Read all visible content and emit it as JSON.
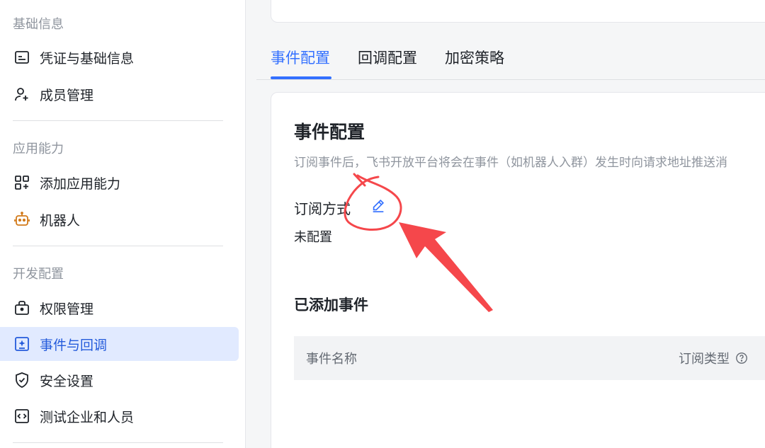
{
  "sidebar": {
    "sections": [
      {
        "title": "基础信息"
      },
      {
        "title": "应用能力"
      },
      {
        "title": "开发配置"
      }
    ],
    "items": [
      {
        "label": "凭证与基础信息",
        "icon": "credential-icon"
      },
      {
        "label": "成员管理",
        "icon": "member-add-icon"
      },
      {
        "label": "添加应用能力",
        "icon": "app-grid-add-icon"
      },
      {
        "label": "机器人",
        "icon": "robot-icon"
      },
      {
        "label": "权限管理",
        "icon": "permission-lock-icon"
      },
      {
        "label": "事件与回调",
        "icon": "event-callback-icon",
        "active": true
      },
      {
        "label": "安全设置",
        "icon": "shield-check-icon"
      },
      {
        "label": "测试企业和人员",
        "icon": "code-doc-icon"
      }
    ]
  },
  "tabs": [
    {
      "label": "事件配置",
      "active": true
    },
    {
      "label": "回调配置"
    },
    {
      "label": "加密策略"
    }
  ],
  "content": {
    "title": "事件配置",
    "description": "订阅事件后，飞书开放平台将会在事件（如机器人入群）发生时向请求地址推送消",
    "subscription_label": "订阅方式",
    "subscription_status": "未配置",
    "events_title": "已添加事件",
    "table_headers": {
      "name": "事件名称",
      "type": "订阅类型"
    }
  },
  "colors": {
    "accent": "#3370ff",
    "active_bg": "#e1eaff",
    "annotation_red": "#f5474b",
    "robot_orange": "#d27a1a"
  }
}
